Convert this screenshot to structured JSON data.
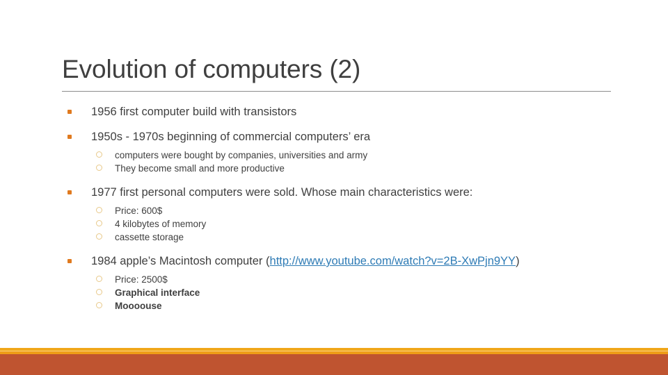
{
  "slide": {
    "title": "Evolution of computers (2)",
    "accent_color": "#bf5430",
    "bullet_color": "#e07a1f",
    "link_color": "#2e7bb5",
    "text_color": "#3f3f3f",
    "background": "#ffffff"
  },
  "bullets": [
    {
      "text": "1956 first computer build with transistors",
      "sub": []
    },
    {
      "text": "1950s - 1970s beginning of commercial computers’ era",
      "sub": [
        "computers were bought by companies, universities and army",
        "They become small and more productive"
      ]
    },
    {
      "text": "1977 first personal computers were sold. Whose main characteristics were:",
      "sub": [
        "Price: 600$",
        "4 kilobytes of memory",
        "cassette storage"
      ]
    },
    {
      "text_prefix": "1984 apple’s Macintosh computer (",
      "link": "http://www.youtube.com/watch?v=2B-XwPjn9YY",
      "text_suffix": ")",
      "sub": [
        "Price: 2500$",
        "Graphical interface",
        "Moooouse"
      ]
    }
  ]
}
